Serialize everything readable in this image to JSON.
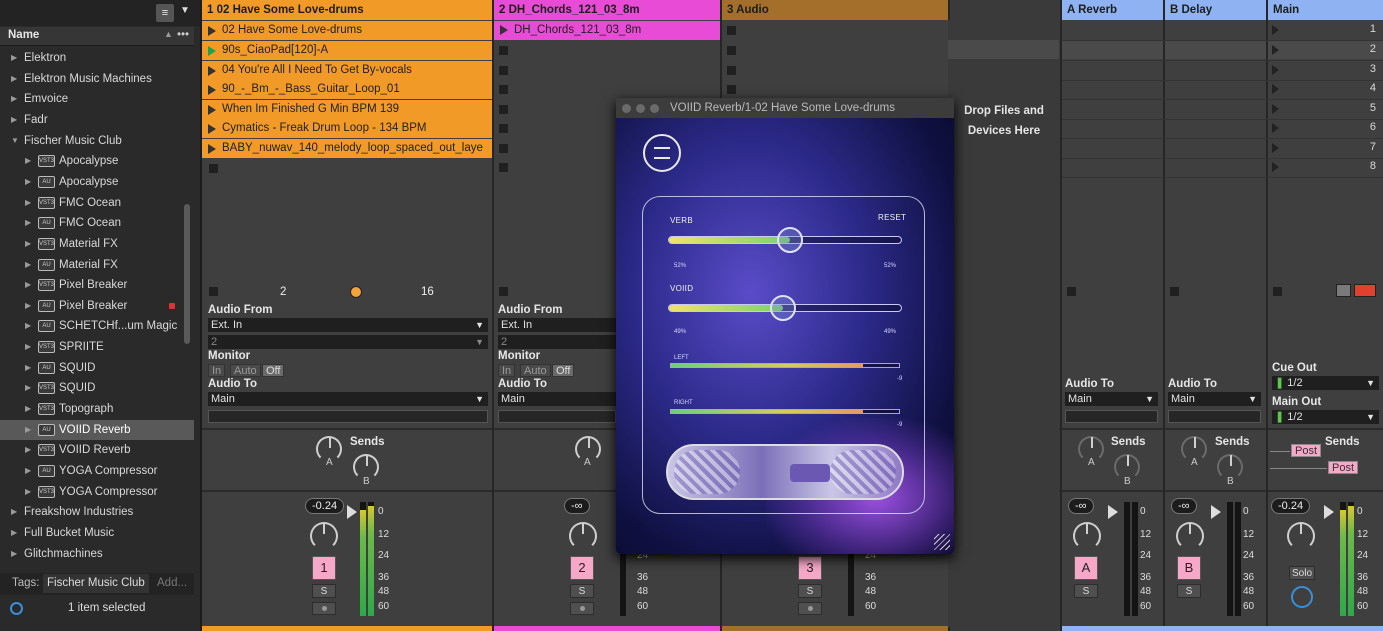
{
  "browser": {
    "header_name": "Name",
    "items": [
      {
        "label": "Elektron",
        "kind": "folder"
      },
      {
        "label": "Elektron Music Machines",
        "kind": "folder"
      },
      {
        "label": "Emvoice",
        "kind": "folder"
      },
      {
        "label": "Fadr",
        "kind": "folder"
      },
      {
        "label": "Fischer Music Club",
        "kind": "folder-open"
      },
      {
        "label": "Apocalypse",
        "kind": "vst3"
      },
      {
        "label": "Apocalypse",
        "kind": "au"
      },
      {
        "label": "FMC Ocean",
        "kind": "vst3"
      },
      {
        "label": "FMC Ocean",
        "kind": "au"
      },
      {
        "label": "Material FX",
        "kind": "vst3"
      },
      {
        "label": "Material FX",
        "kind": "au"
      },
      {
        "label": "Pixel Breaker",
        "kind": "vst3"
      },
      {
        "label": "Pixel Breaker",
        "kind": "au"
      },
      {
        "label": "SCHETCHf...um Magic",
        "kind": "au"
      },
      {
        "label": "SPRIITE",
        "kind": "vst3"
      },
      {
        "label": "SQUID",
        "kind": "au"
      },
      {
        "label": "SQUID",
        "kind": "vst3"
      },
      {
        "label": "Topograph",
        "kind": "vst3"
      },
      {
        "label": "VOIID Reverb",
        "kind": "au"
      },
      {
        "label": "VOIID Reverb",
        "kind": "vst3"
      },
      {
        "label": "YOGA Compressor",
        "kind": "au"
      },
      {
        "label": "YOGA Compressor",
        "kind": "vst3"
      },
      {
        "label": "Freakshow Industries",
        "kind": "folder"
      },
      {
        "label": "Full Bucket Music",
        "kind": "folder"
      },
      {
        "label": "Glitchmachines",
        "kind": "folder"
      }
    ],
    "tags_label": "Tags:",
    "tag": "Fischer Music Club",
    "tag_add": "Add...",
    "status": "1 item selected"
  },
  "tracks": [
    {
      "title": "1 02 Have Some Love-drums",
      "color": "#f29a27"
    },
    {
      "title": "2 DH_Chords_121_03_8m",
      "color": "#e84bd6"
    },
    {
      "title": "3 Audio",
      "color": "#a36f2b"
    },
    {
      "title": "A Reverb",
      "color": "#8fb3f2"
    },
    {
      "title": "B Delay",
      "color": "#8fb3f2"
    },
    {
      "title": "Main",
      "color": "#8fb3f2"
    }
  ],
  "clips_track1": [
    "02 Have Some Love-drums",
    "90s_CiaoPad[120]-A",
    "04 You're All I Need To Get By-vocals",
    "90_-_Bm_-_Bass_Guitar_Loop_01",
    "When Im Finished G Min BPM 139",
    "Cymatics - Freak Drum Loop - 134 BPM",
    "BABY_nuwav_140_melody_loop_spaced_out_laye"
  ],
  "clip_track2": "DH_Chords_121_03_8m",
  "scene_numbers": [
    "1",
    "2",
    "3",
    "4",
    "5",
    "6",
    "7",
    "8"
  ],
  "io": {
    "audio_from": "Audio From",
    "ext_in": "Ext. In",
    "input_ch": "2",
    "monitor": "Monitor",
    "mon_in": "In",
    "mon_auto": "Auto",
    "mon_off": "Off",
    "audio_to": "Audio To",
    "main": "Main",
    "cue_out": "Cue Out",
    "cue_val": "1/2",
    "main_out": "Main Out",
    "main_out_val": "1/2",
    "quantize_a": "2",
    "quantize_b": "16"
  },
  "mixer": {
    "sends": "Sends",
    "send_a": "A",
    "send_b": "B",
    "vol1": "-0.24",
    "vol2": "-∞",
    "volA": "-∞",
    "volB": "-∞",
    "volM": "-0.24",
    "num1": "1",
    "num2": "2",
    "num3": "3",
    "numA": "A",
    "numB": "B",
    "solo": "S",
    "solo_main": "Solo",
    "post": "Post",
    "scale": [
      "0",
      "12",
      "24",
      "36",
      "48",
      "60"
    ]
  },
  "drop_zone": "Drop Files and Devices Here",
  "plugin": {
    "title": "VOIID Reverb/1-02 Have Some Love-drums",
    "verb": "VERB",
    "reset": "RESET",
    "verb_l": "52%",
    "verb_r": "52%",
    "voiid": "VOIID",
    "voiid_l": "49%",
    "voiid_r": "49%",
    "left": "LEFT",
    "right": "RIGHT",
    "left_db": "-9",
    "right_db": "-9",
    "verb_level": 0.52,
    "voiid_level": 0.49
  }
}
